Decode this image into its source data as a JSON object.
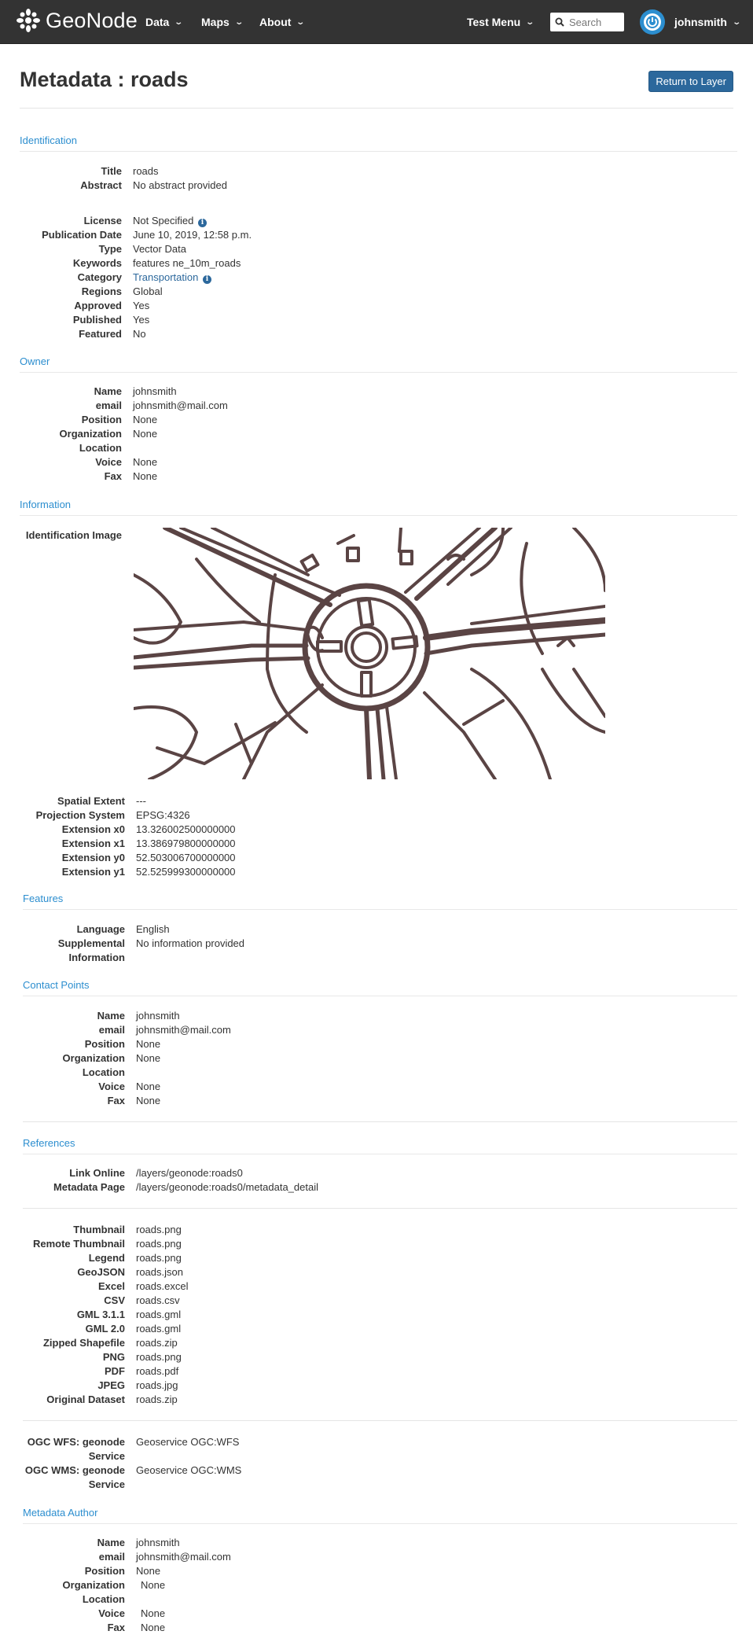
{
  "navbar": {
    "brand": "GeoNode",
    "menus": [
      "Data",
      "Maps",
      "About"
    ],
    "test_menu": "Test Menu",
    "search_placeholder": "Search",
    "user": "johnsmith"
  },
  "header": {
    "title": "Metadata : roads",
    "return_button": "Return to Layer"
  },
  "identification": {
    "heading": "Identification",
    "title_label": "Title",
    "title_value": "roads",
    "abstract_label": "Abstract",
    "abstract_value": "No abstract provided",
    "license_label": "License",
    "license_value": "Not Specified",
    "pubdate_label": "Publication Date",
    "pubdate_value": "June 10, 2019, 12:58 p.m.",
    "type_label": "Type",
    "type_value": "Vector Data",
    "keywords_label": "Keywords",
    "keywords_value": "features ne_10m_roads",
    "category_label": "Category",
    "category_value": "Transportation",
    "regions_label": "Regions",
    "regions_value": "Global",
    "approved_label": "Approved",
    "approved_value": "Yes",
    "published_label": "Published",
    "published_value": "Yes",
    "featured_label": "Featured",
    "featured_value": "No"
  },
  "owner": {
    "heading": "Owner",
    "rows": [
      {
        "label": "Name",
        "value": "johnsmith"
      },
      {
        "label": "email",
        "value": "johnsmith@mail.com"
      },
      {
        "label": "Position",
        "value": "None"
      },
      {
        "label": "Organization",
        "value": "None"
      },
      {
        "label": "Location",
        "value": ""
      },
      {
        "label": "Voice",
        "value": "None"
      },
      {
        "label": "Fax",
        "value": "None"
      }
    ]
  },
  "information": {
    "heading": "Information",
    "image_label": "Identification Image",
    "spatial_label": "Spatial Extent",
    "spatial_value": "---",
    "proj_label": "Projection System",
    "proj_value": "EPSG:4326",
    "x0_label": "Extension x0",
    "x0_value": "13.326002500000000",
    "x1_label": "Extension x1",
    "x1_value": "13.386979800000000",
    "y0_label": "Extension y0",
    "y0_value": "52.503006700000000",
    "y1_label": "Extension y1",
    "y1_value": "52.525999300000000"
  },
  "features": {
    "heading": "Features",
    "language_label": "Language",
    "language_value": "English",
    "supp_label_1": "Supplemental",
    "supp_label_2": "Information",
    "supp_value": "No information provided"
  },
  "contact": {
    "heading": "Contact Points",
    "rows": [
      {
        "label": "Name",
        "value": "johnsmith"
      },
      {
        "label": "email",
        "value": "johnsmith@mail.com"
      },
      {
        "label": "Position",
        "value": "None"
      },
      {
        "label": "Organization",
        "value": "None"
      },
      {
        "label": "Location",
        "value": ""
      },
      {
        "label": "Voice",
        "value": "None"
      },
      {
        "label": "Fax",
        "value": "None"
      }
    ]
  },
  "references": {
    "heading": "References",
    "links": [
      {
        "label": "Link Online",
        "value": "/layers/geonode:roads0"
      },
      {
        "label": "Metadata Page",
        "value": "/layers/geonode:roads0/metadata_detail"
      }
    ],
    "downloads": [
      {
        "label": "Thumbnail",
        "value": "roads.png"
      },
      {
        "label": "Remote Thumbnail",
        "value": "roads.png"
      },
      {
        "label": "Legend",
        "value": "roads.png"
      },
      {
        "label": "GeoJSON",
        "value": "roads.json"
      },
      {
        "label": "Excel",
        "value": "roads.excel"
      },
      {
        "label": "CSV",
        "value": "roads.csv"
      },
      {
        "label": "GML 3.1.1",
        "value": "roads.gml"
      },
      {
        "label": "GML 2.0",
        "value": "roads.gml"
      },
      {
        "label": "Zipped Shapefile",
        "value": "roads.zip"
      },
      {
        "label": "PNG",
        "value": "roads.png"
      },
      {
        "label": "PDF",
        "value": "roads.pdf"
      },
      {
        "label": "JPEG",
        "value": "roads.jpg"
      },
      {
        "label": "Original Dataset",
        "value": "roads.zip"
      }
    ],
    "services": [
      {
        "label_1": "OGC WFS: geonode",
        "label_2": "Service",
        "value": "Geoservice OGC:WFS"
      },
      {
        "label_1": "OGC WMS: geonode",
        "label_2": "Service",
        "value": "Geoservice OGC:WMS"
      }
    ]
  },
  "metadata_author": {
    "heading": "Metadata Author",
    "rows": [
      {
        "label": "Name",
        "value": "johnsmith"
      },
      {
        "label": "email",
        "value": "johnsmith@mail.com"
      },
      {
        "label": "Position",
        "value": "None"
      },
      {
        "label": "Organization",
        "value": "None"
      },
      {
        "label": "Location",
        "value": ""
      },
      {
        "label": "Voice",
        "value": "None"
      },
      {
        "label": "Fax",
        "value": "None"
      }
    ]
  },
  "colors": {
    "navbar_bg": "#333333",
    "link": "#2c689c",
    "section_heading": "#2c8ecf",
    "map_roads": "#5a4444"
  }
}
